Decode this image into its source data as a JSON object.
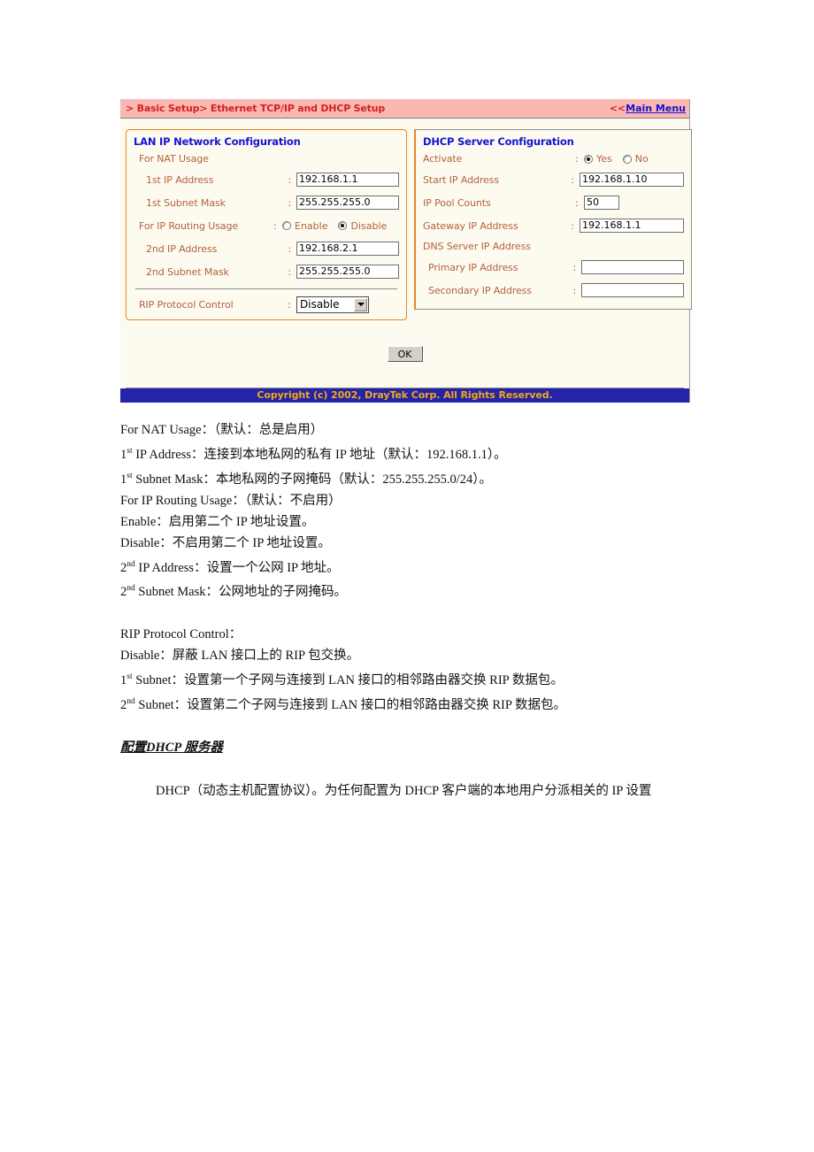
{
  "router_ui": {
    "header": {
      "breadcrumb": "> Basic Setup> Ethernet TCP/IP and DHCP Setup",
      "main_menu_arrows": "<<",
      "main_menu_label": "Main Menu"
    },
    "lan_panel": {
      "title": "LAN IP Network Configuration",
      "nat_usage_label": "For NAT Usage",
      "first_ip_label": "1st IP Address",
      "first_ip_value": "192.168.1.1",
      "first_mask_label": "1st Subnet Mask",
      "first_mask_value": "255.255.255.0",
      "routing_usage_label": "For IP Routing Usage",
      "enable_label": "Enable",
      "disable_label": "Disable",
      "routing_selected": "Disable",
      "second_ip_label": "2nd IP Address",
      "second_ip_value": "192.168.2.1",
      "second_mask_label": "2nd Subnet Mask",
      "second_mask_value": "255.255.255.0",
      "rip_label": "RIP Protocol Control",
      "rip_value": "Disable",
      "colon": ":"
    },
    "dhcp_panel": {
      "title": "DHCP Server Configuration",
      "activate_label": "Activate",
      "yes_label": "Yes",
      "no_label": "No",
      "activate_selected": "Yes",
      "start_ip_label": "Start IP Address",
      "start_ip_value": "192.168.1.10",
      "pool_counts_label": "IP Pool Counts",
      "pool_counts_value": "50",
      "gateway_label": "Gateway IP Address",
      "gateway_value": "192.168.1.1",
      "dns_header_label": "DNS Server IP Address",
      "primary_label": "Primary IP Address",
      "primary_value": "",
      "secondary_label": "Secondary IP Address",
      "secondary_value": "",
      "colon": ":"
    },
    "ok_button_label": "OK",
    "copyright": "Copyright (c) 2002, DrayTek Corp. All Rights Reserved.",
    "colors": {
      "header_bg": "#f9b8b2",
      "header_text": "#d42020",
      "panel_bg": "#fdfbf0",
      "panel_title": "#1414d2",
      "field_label": "#b4603c",
      "lan_border": "#e8862a",
      "footer_bg": "#2424a8",
      "footer_text": "#f0a818",
      "link": "#1414d2"
    }
  },
  "document": {
    "lines": [
      {
        "pre": "For NAT Usage",
        "sup": "",
        "post": "：（默认：总是启用）"
      },
      {
        "pre": "1",
        "sup": "st",
        "post": " IP Address：连接到本地私网的私有 IP 地址（默认：192.168.1.1）。"
      },
      {
        "pre": "1",
        "sup": "st",
        "post": " Subnet Mask：本地私网的子网掩码（默认：255.255.255.0/24）。"
      },
      {
        "pre": "For IP Routing Usage",
        "sup": "",
        "post": "：（默认：不启用）"
      },
      {
        "pre": "Enable",
        "sup": "",
        "post": "：启用第二个 IP 地址设置。"
      },
      {
        "pre": "Disable",
        "sup": "",
        "post": "：不启用第二个 IP 地址设置。"
      },
      {
        "pre": "2",
        "sup": "nd",
        "post": " IP Address：设置一个公网 IP 地址。"
      },
      {
        "pre": "2",
        "sup": "nd",
        "post": " Subnet Mask：公网地址的子网掩码。"
      },
      {
        "pre": "",
        "sup": "",
        "post": ""
      },
      {
        "pre": "RIP Protocol Control",
        "sup": "",
        "post": "："
      },
      {
        "pre": "Disable",
        "sup": "",
        "post": "：屏蔽 LAN 接口上的 RIP 包交换。"
      },
      {
        "pre": "1",
        "sup": "st",
        "post": " Subnet：设置第一个子网与连接到 LAN 接口的相邻路由器交换 RIP 数据包。"
      },
      {
        "pre": "2",
        "sup": "nd",
        "post": " Subnet：设置第二个子网与连接到 LAN 接口的相邻路由器交换 RIP 数据包。"
      }
    ],
    "section_heading": "配置DHCP 服务器",
    "paragraph": "DHCP（动态主机配置协议）。为任何配置为 DHCP 客户端的本地用户分派相关的 IP 设置"
  }
}
